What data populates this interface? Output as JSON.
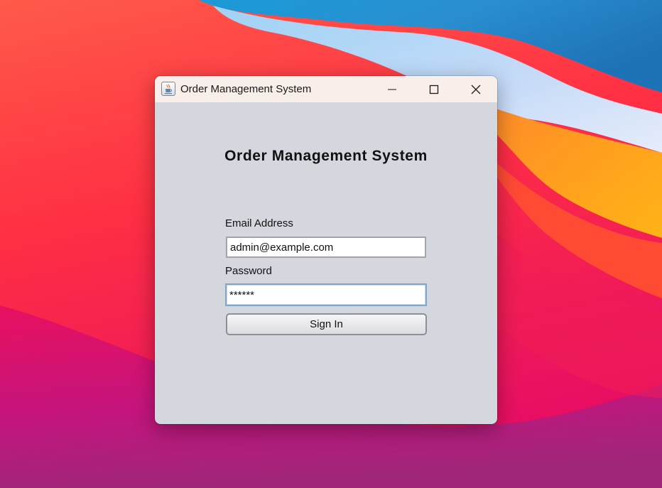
{
  "window": {
    "title": "Order Management System",
    "app_icon": "java-cup-icon",
    "controls": {
      "minimize_icon": "minimize-icon",
      "maximize_icon": "maximize-icon",
      "close_icon": "close-icon"
    }
  },
  "form": {
    "heading": "Order Management System",
    "email": {
      "label": "Email Address",
      "value": "admin@example.com",
      "placeholder": ""
    },
    "password": {
      "label": "Password",
      "value": "******",
      "placeholder": ""
    },
    "sign_in_label": "Sign In"
  },
  "colors": {
    "window_background": "#d5d7de",
    "titlebar_background": "#f8efea",
    "focus_border": "#86a6c7"
  }
}
